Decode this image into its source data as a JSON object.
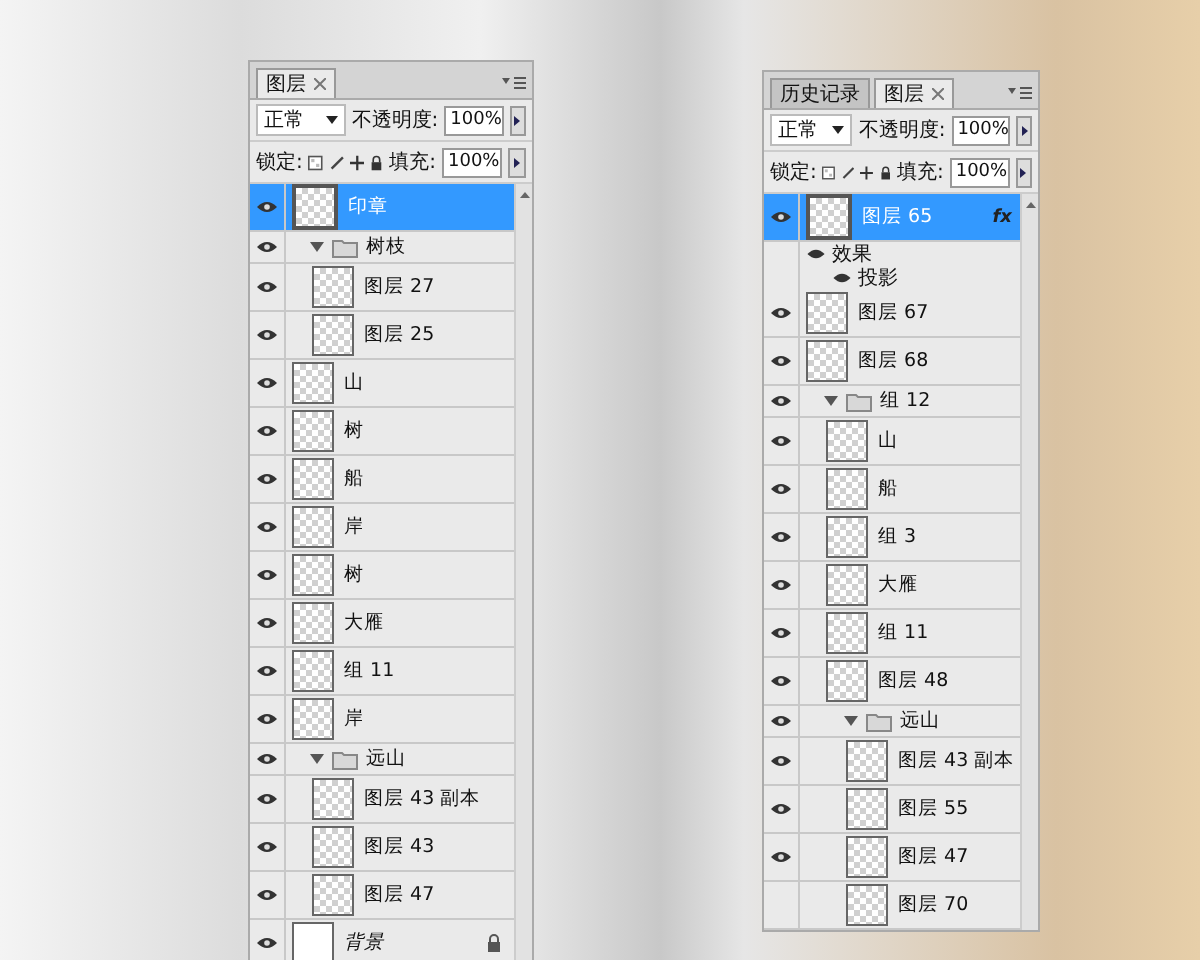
{
  "panels": [
    {
      "tabs": [
        {
          "label": "图层",
          "selected": true
        }
      ],
      "blend_mode": "正常",
      "opacity_label": "不透明度:",
      "opacity_value": "100%",
      "lock_label": "锁定:",
      "fill_label": "填充:",
      "fill_value": "100%",
      "layers": [
        {
          "kind": "layer",
          "name": "印章",
          "visible": true,
          "selected": true
        },
        {
          "kind": "group",
          "name": "树枝",
          "visible": true,
          "selected": false,
          "expanded": true,
          "children": [
            {
              "kind": "layer",
              "name": "图层 27",
              "visible": true,
              "selected": false
            },
            {
              "kind": "layer",
              "name": "图层 25",
              "visible": true,
              "selected": false
            }
          ]
        },
        {
          "kind": "layer",
          "name": "山",
          "visible": true,
          "selected": false
        },
        {
          "kind": "layer",
          "name": "树",
          "visible": true,
          "selected": false
        },
        {
          "kind": "layer",
          "name": "船",
          "visible": true,
          "selected": false
        },
        {
          "kind": "layer",
          "name": "岸",
          "visible": true,
          "selected": false
        },
        {
          "kind": "layer",
          "name": "树",
          "visible": true,
          "selected": false
        },
        {
          "kind": "layer",
          "name": "大雁",
          "visible": true,
          "selected": false
        },
        {
          "kind": "layer",
          "name": "组 11",
          "visible": true,
          "selected": false
        },
        {
          "kind": "layer",
          "name": "岸",
          "visible": true,
          "selected": false
        },
        {
          "kind": "group",
          "name": "远山",
          "visible": true,
          "selected": false,
          "expanded": true,
          "children": [
            {
              "kind": "layer",
              "name": "图层 43 副本",
              "visible": true,
              "selected": false
            },
            {
              "kind": "layer",
              "name": "图层 43",
              "visible": true,
              "selected": false
            },
            {
              "kind": "layer",
              "name": "图层 47",
              "visible": true,
              "selected": false
            }
          ]
        },
        {
          "kind": "background",
          "name": "背景",
          "visible": true,
          "selected": false
        }
      ]
    },
    {
      "tabs": [
        {
          "label": "历史记录",
          "selected": false
        },
        {
          "label": "图层",
          "selected": true
        }
      ],
      "blend_mode": "正常",
      "opacity_label": "不透明度:",
      "opacity_value": "100%",
      "lock_label": "锁定:",
      "fill_label": "填充:",
      "fill_value": "100%",
      "layers": [
        {
          "kind": "layer",
          "name": "图层 65",
          "visible": true,
          "selected": true,
          "fx": "fx",
          "effects": {
            "label": "效果",
            "items": [
              "投影"
            ]
          }
        },
        {
          "kind": "layer",
          "name": "图层 67",
          "visible": true,
          "selected": false
        },
        {
          "kind": "layer",
          "name": "图层 68",
          "visible": true,
          "selected": false
        },
        {
          "kind": "group",
          "name": "组 12",
          "visible": true,
          "selected": false,
          "expanded": true,
          "children": [
            {
              "kind": "layer",
              "name": "山",
              "visible": true,
              "selected": false
            },
            {
              "kind": "layer",
              "name": "船",
              "visible": true,
              "selected": false
            },
            {
              "kind": "layer",
              "name": "组 3",
              "visible": true,
              "selected": false
            },
            {
              "kind": "layer",
              "name": "大雁",
              "visible": true,
              "selected": false
            },
            {
              "kind": "layer",
              "name": "组 11",
              "visible": true,
              "selected": false
            },
            {
              "kind": "layer",
              "name": "图层 48",
              "visible": true,
              "selected": false
            },
            {
              "kind": "group",
              "name": "远山",
              "visible": true,
              "selected": false,
              "expanded": true,
              "children": [
                {
                  "kind": "layer",
                  "name": "图层 43 副本",
                  "visible": true,
                  "selected": false
                },
                {
                  "kind": "layer",
                  "name": "图层 55",
                  "visible": true,
                  "selected": false
                },
                {
                  "kind": "layer",
                  "name": "图层 47",
                  "visible": true,
                  "selected": false
                },
                {
                  "kind": "layer",
                  "name": "图层 70",
                  "visible": false,
                  "selected": false
                }
              ]
            }
          ]
        }
      ]
    }
  ]
}
